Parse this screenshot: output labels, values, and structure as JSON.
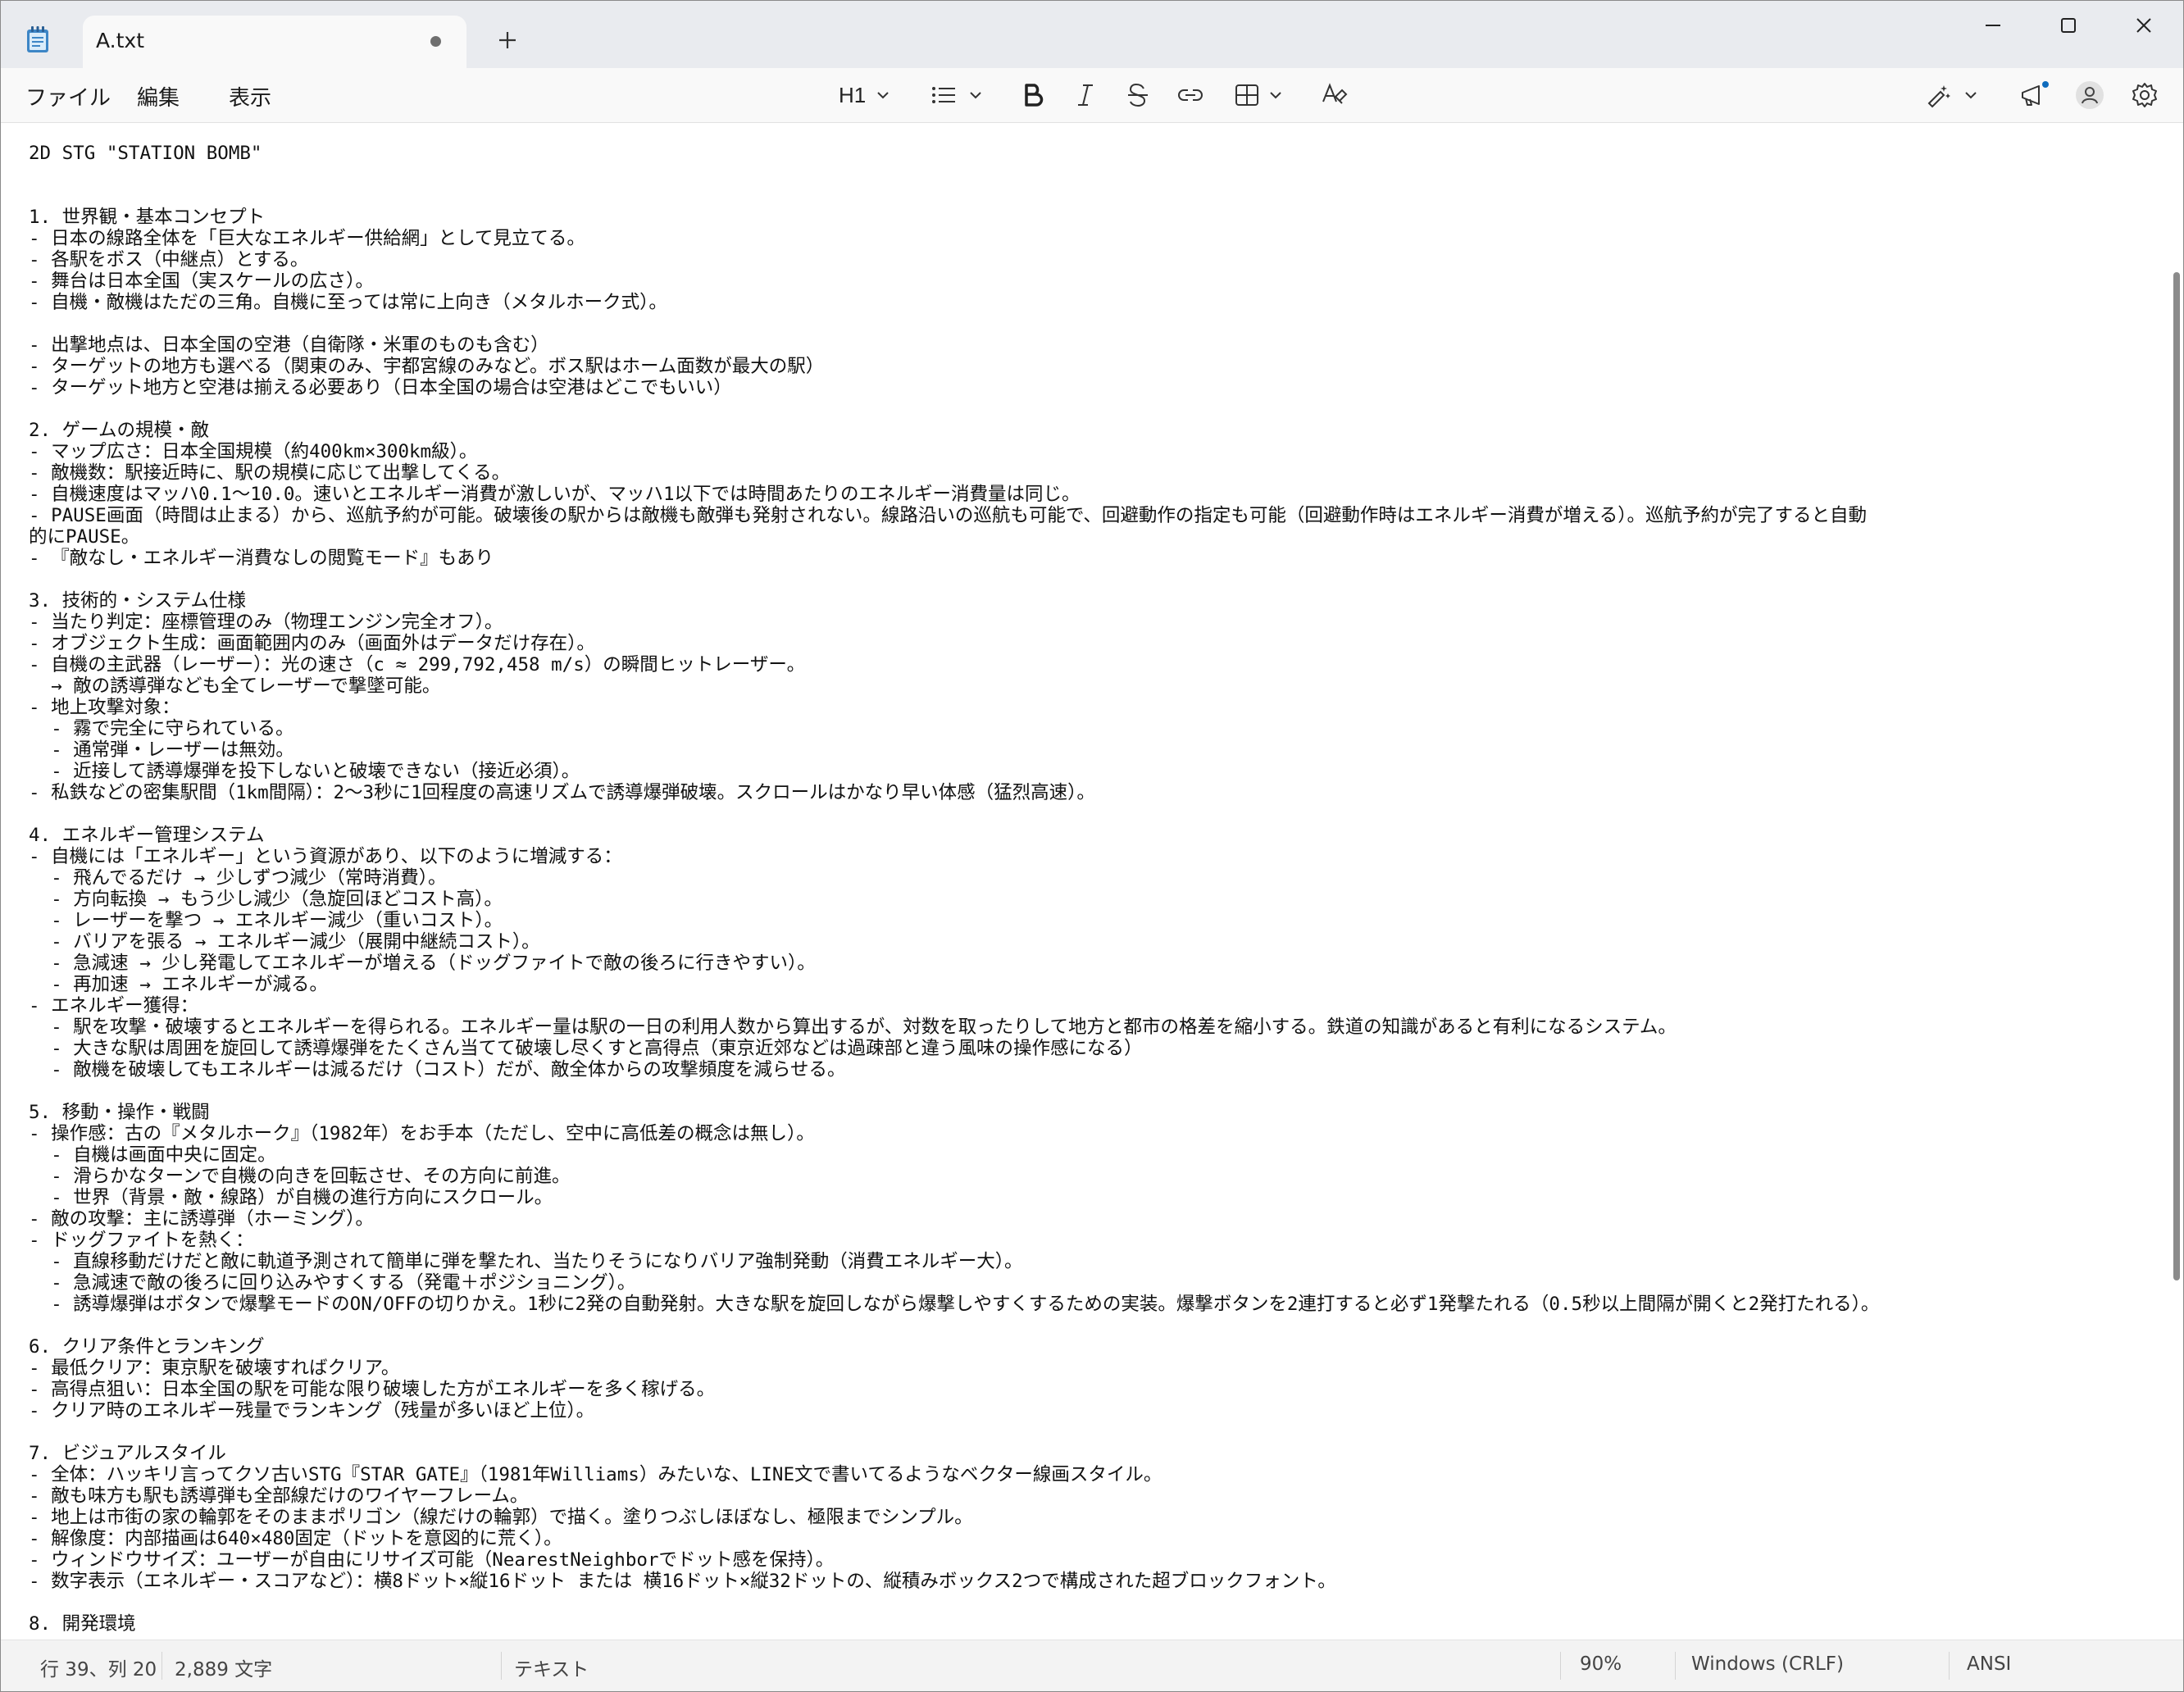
{
  "tab": {
    "title": "A.txt"
  },
  "menu": {
    "file": "ファイル",
    "edit": "編集",
    "view": "表示"
  },
  "toolbar": {
    "heading": "H1"
  },
  "editor": {
    "lines": [
      "2D STG \"STATION BOMB\"",
      "",
      "",
      "1. 世界観・基本コンセプト",
      "- 日本の線路全体を「巨大なエネルギー供給網」として見立てる。",
      "- 各駅をボス（中継点）とする。",
      "- 舞台は日本全国（実スケールの広さ）。",
      "- 自機・敵機はただの三角。自機に至っては常に上向き（メタルホーク式）。",
      "",
      "- 出撃地点は、日本全国の空港（自衛隊・米軍のものも含む）",
      "- ターゲットの地方も選べる（関東のみ、宇都宮線のみなど。ボス駅はホーム面数が最大の駅）",
      "- ターゲット地方と空港は揃える必要あり（日本全国の場合は空港はどこでもいい）",
      "",
      "2. ゲームの規模・敵",
      "- マップ広さ：日本全国規模（約400km×300km級）。",
      "- 敵機数：駅接近時に、駅の規模に応じて出撃してくる。",
      "- 自機速度はマッハ0.1〜10.0。速いとエネルギー消費が激しいが、マッハ1以下では時間あたりのエネルギー消費量は同じ。",
      "- PAUSE画面（時間は止まる）から、巡航予約が可能。破壊後の駅からは敵機も敵弾も発射されない。線路沿いの巡航も可能で、回避動作の指定も可能（回避動作時はエネルギー消費が増える）。巡航予約が完了すると自動",
      "的にPAUSE。",
      "- 『敵なし・エネルギー消費なしの閲覧モード』もあり",
      "",
      "3. 技術的・システム仕様",
      "- 当たり判定：座標管理のみ（物理エンジン完全オフ）。",
      "- オブジェクト生成：画面範囲内のみ（画面外はデータだけ存在）。",
      "- 自機の主武器（レーザー）：光の速さ（c ≈ 299,792,458 m/s）の瞬間ヒットレーザー。",
      "  → 敵の誘導弾なども全てレーザーで撃墜可能。",
      "- 地上攻撃対象：",
      "  - 霧で完全に守られている。",
      "  - 通常弾・レーザーは無効。",
      "  - 近接して誘導爆弾を投下しないと破壊できない（接近必須）。",
      "- 私鉄などの密集駅間（1km間隔）：2〜3秒に1回程度の高速リズムで誘導爆弾破壊。スクロールはかなり早い体感（猛烈高速）。",
      "",
      "4. エネルギー管理システム",
      "- 自機には「エネルギー」という資源があり、以下のように増減する：",
      "  - 飛んでるだけ → 少しずつ減少（常時消費）。",
      "  - 方向転換 → もう少し減少（急旋回ほどコスト高）。",
      "  - レーザーを撃つ → エネルギー減少（重いコスト）。",
      "  - バリアを張る → エネルギー減少（展開中継続コスト）。",
      "  - 急減速 → 少し発電してエネルギーが増える（ドッグファイトで敵の後ろに行きやすい）。",
      "  - 再加速 → エネルギーが減る。",
      "- エネルギー獲得：",
      "  - 駅を攻撃・破壊するとエネルギーを得られる。エネルギー量は駅の一日の利用人数から算出するが、対数を取ったりして地方と都市の格差を縮小する。鉄道の知識があると有利になるシステム。",
      "  - 大きな駅は周囲を旋回して誘導爆弾をたくさん当てて破壊し尽くすと高得点（東京近郊などは過疎部と違う風味の操作感になる）",
      "  - 敵機を破壊してもエネルギーは減るだけ（コスト）だが、敵全体からの攻撃頻度を減らせる。",
      "",
      "5. 移動・操作・戦闘",
      "- 操作感：古の『メタルホーク』（1982年）をお手本（ただし、空中に高低差の概念は無し）。",
      "  - 自機は画面中央に固定。",
      "  - 滑らかなターンで自機の向きを回転させ、その方向に前進。",
      "  - 世界（背景・敵・線路）が自機の進行方向にスクロール。",
      "- 敵の攻撃：主に誘導弾（ホーミング）。",
      "- ドッグファイトを熱く：",
      "  - 直線移動だけだと敵に軌道予測されて簡単に弾を撃たれ、当たりそうになりバリア強制発動（消費エネルギー大）。",
      "  - 急減速で敵の後ろに回り込みやすくする（発電＋ポジショニング）。",
      "  - 誘導爆弾はボタンで爆撃モードのON/OFFの切りかえ。1秒に2発の自動発射。大きな駅を旋回しながら爆撃しやすくするための実装。爆撃ボタンを2連打すると必ず1発撃たれる（0.5秒以上間隔が開くと2発打たれる）。",
      "",
      "6. クリア条件とランキング",
      "- 最低クリア：東京駅を破壊すればクリア。",
      "- 高得点狙い：日本全国の駅を可能な限り破壊した方がエネルギーを多く稼げる。",
      "- クリア時のエネルギー残量でランキング（残量が多いほど上位）。",
      "",
      "7. ビジュアルスタイル",
      "- 全体：ハッキリ言ってクソ古いSTG『STAR GATE』（1981年Williams）みたいな、LINE文で書いてるようなベクター線画スタイル。",
      "- 敵も味方も駅も誘導弾も全部線だけのワイヤーフレーム。",
      "- 地上は市街の家の輪郭をそのままポリゴン（線だけの輪郭）で描く。塗りつぶしほぼなし、極限までシンプル。",
      "- 解像度：内部描画は640×480固定（ドットを意図的に荒く）。",
      "- ウィンドウサイズ：ユーザーが自由にリサイズ可能（NearestNeighborでドット感を保持）。",
      "- 数字表示（エネルギー・スコアなど）：横8ドット×縦16ドット または 横16ドット×縦32ドットの、縦積みボックス2つで構成された超ブロックフォント。",
      "",
      "8. 開発環境"
    ]
  },
  "status": {
    "position": "行 39、列 20",
    "chars": "2,889 文字",
    "mode": "テキスト",
    "zoom": "90%",
    "eol": "Windows (CRLF)",
    "encoding": "ANSI"
  }
}
